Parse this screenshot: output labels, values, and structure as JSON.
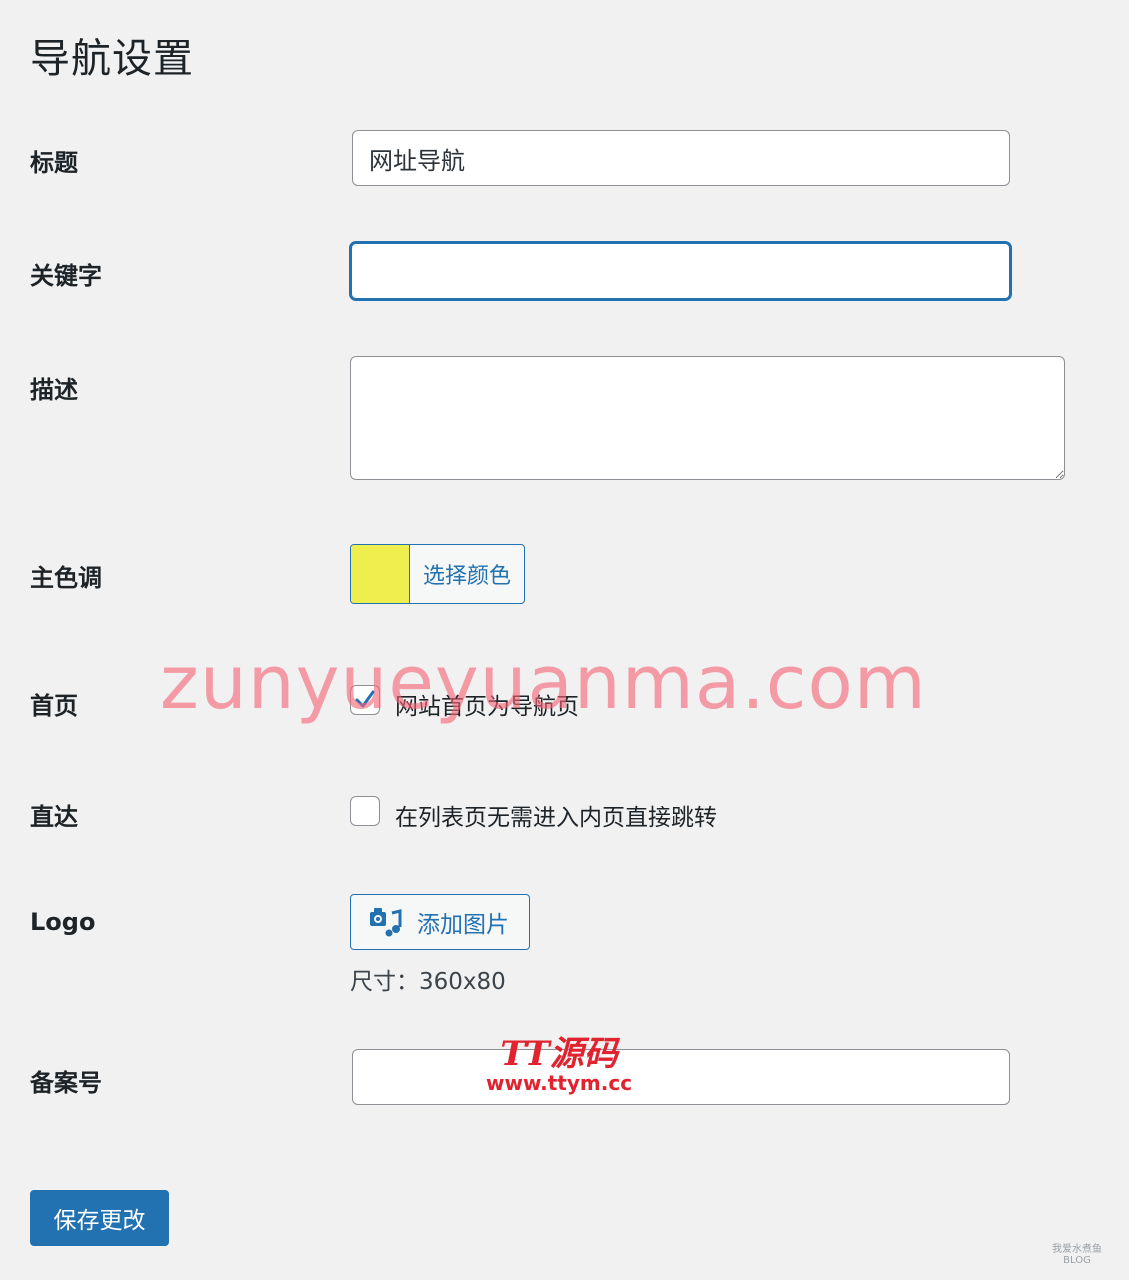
{
  "page": {
    "title": "导航设置"
  },
  "fields": {
    "title": {
      "label": "标题",
      "value": "网址导航"
    },
    "keywords": {
      "label": "关键字",
      "value": ""
    },
    "description": {
      "label": "描述",
      "value": ""
    },
    "main_color": {
      "label": "主色调",
      "button_label": "选择颜色",
      "swatch_color": "#eeee4e"
    },
    "homepage": {
      "label": "首页",
      "checkbox_label": "网站首页为导航页",
      "checked": true
    },
    "direct": {
      "label": "直达",
      "checkbox_label": "在列表页无需进入内页直接跳转",
      "checked": false
    },
    "logo": {
      "label": "Logo",
      "button_label": "添加图片",
      "hint": "尺寸：360x80"
    },
    "icp": {
      "label": "备案号",
      "value": ""
    }
  },
  "actions": {
    "save_label": "保存更改"
  },
  "watermarks": {
    "main": "zunyueyuanma.com",
    "badge_brand": "TT源码",
    "badge_url": "www.ttym.cc",
    "corner_line1": "我爱水煮鱼",
    "corner_line2": "BLOG"
  },
  "colors": {
    "accent": "#2271b1",
    "background": "#f1f1f1",
    "swatch": "#eeee4e"
  }
}
